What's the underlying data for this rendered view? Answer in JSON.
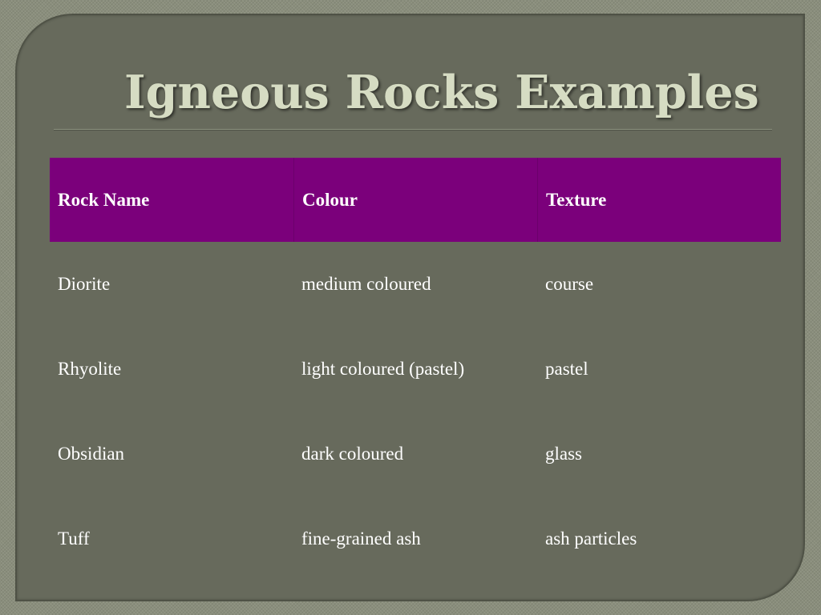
{
  "slide": {
    "title": "Igneous Rocks Examples"
  },
  "table": {
    "headers": [
      "Rock Name",
      "Colour",
      "Texture"
    ],
    "rows": [
      [
        "Diorite",
        "medium coloured",
        "course"
      ],
      [
        "Rhyolite",
        "light coloured (pastel)",
        "pastel"
      ],
      [
        "Obsidian",
        "dark coloured",
        "glass"
      ],
      [
        "Tuff",
        "fine-grained ash",
        "ash particles"
      ]
    ]
  },
  "colors": {
    "header_background": "#7b007b",
    "slide_background": "#676a5c",
    "title_color": "#d6dcc3",
    "body_text": "#ffffff"
  }
}
